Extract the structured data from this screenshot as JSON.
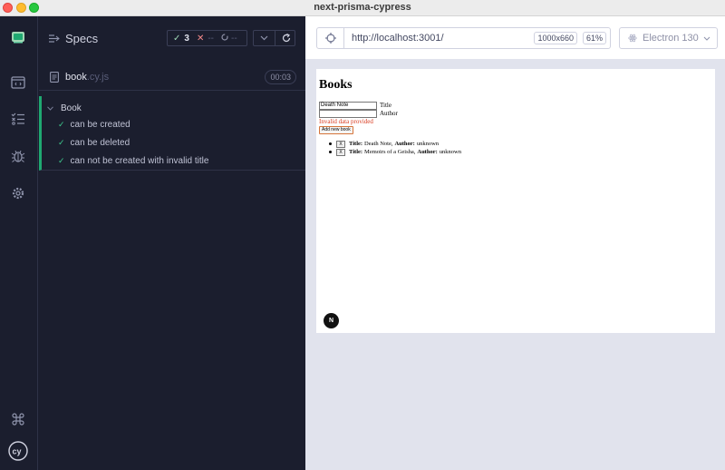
{
  "window": {
    "title": "next-prisma-cypress"
  },
  "rail": {
    "icons": [
      "cypress-logo-icon",
      "specs-list-icon",
      "runs-icon",
      "debug-icon",
      "settings-icon",
      "keyboard-shortcuts-icon",
      "cy-icon"
    ]
  },
  "specs": {
    "title": "Specs",
    "stats": {
      "passed": "3",
      "failed": "--",
      "pending": "--"
    },
    "file": {
      "name": "book",
      "ext": ".cy.js",
      "duration": "00:03"
    },
    "suite": {
      "name": "Book",
      "tests": [
        {
          "title": "can be created",
          "state": "passed"
        },
        {
          "title": "can be deleted",
          "state": "passed"
        },
        {
          "title": "can not be created with invalid title",
          "state": "passed"
        }
      ]
    }
  },
  "toolbar": {
    "url": "http://localhost:3001/",
    "viewport": "1000x660",
    "zoom": "61%",
    "browser": "Electron 130"
  },
  "app": {
    "heading": "Books",
    "title_value": "Death Note",
    "title_label": "Title",
    "author_value": "",
    "author_label": "Author",
    "error": "Invalid data provided",
    "add_button": "Add new book",
    "delete_label": "X",
    "title_key": "Title:",
    "author_key": "Author:",
    "books": [
      {
        "title": "Death Note,",
        "author": "unknown"
      },
      {
        "title": "Memoirs of a Geisha,",
        "author": "unknown"
      }
    ],
    "badge": "N"
  },
  "colors": {
    "pass": "#1fa971",
    "fail": "#f58a8a",
    "sidebar": "#1b1e2e",
    "error": "#d93b20"
  }
}
